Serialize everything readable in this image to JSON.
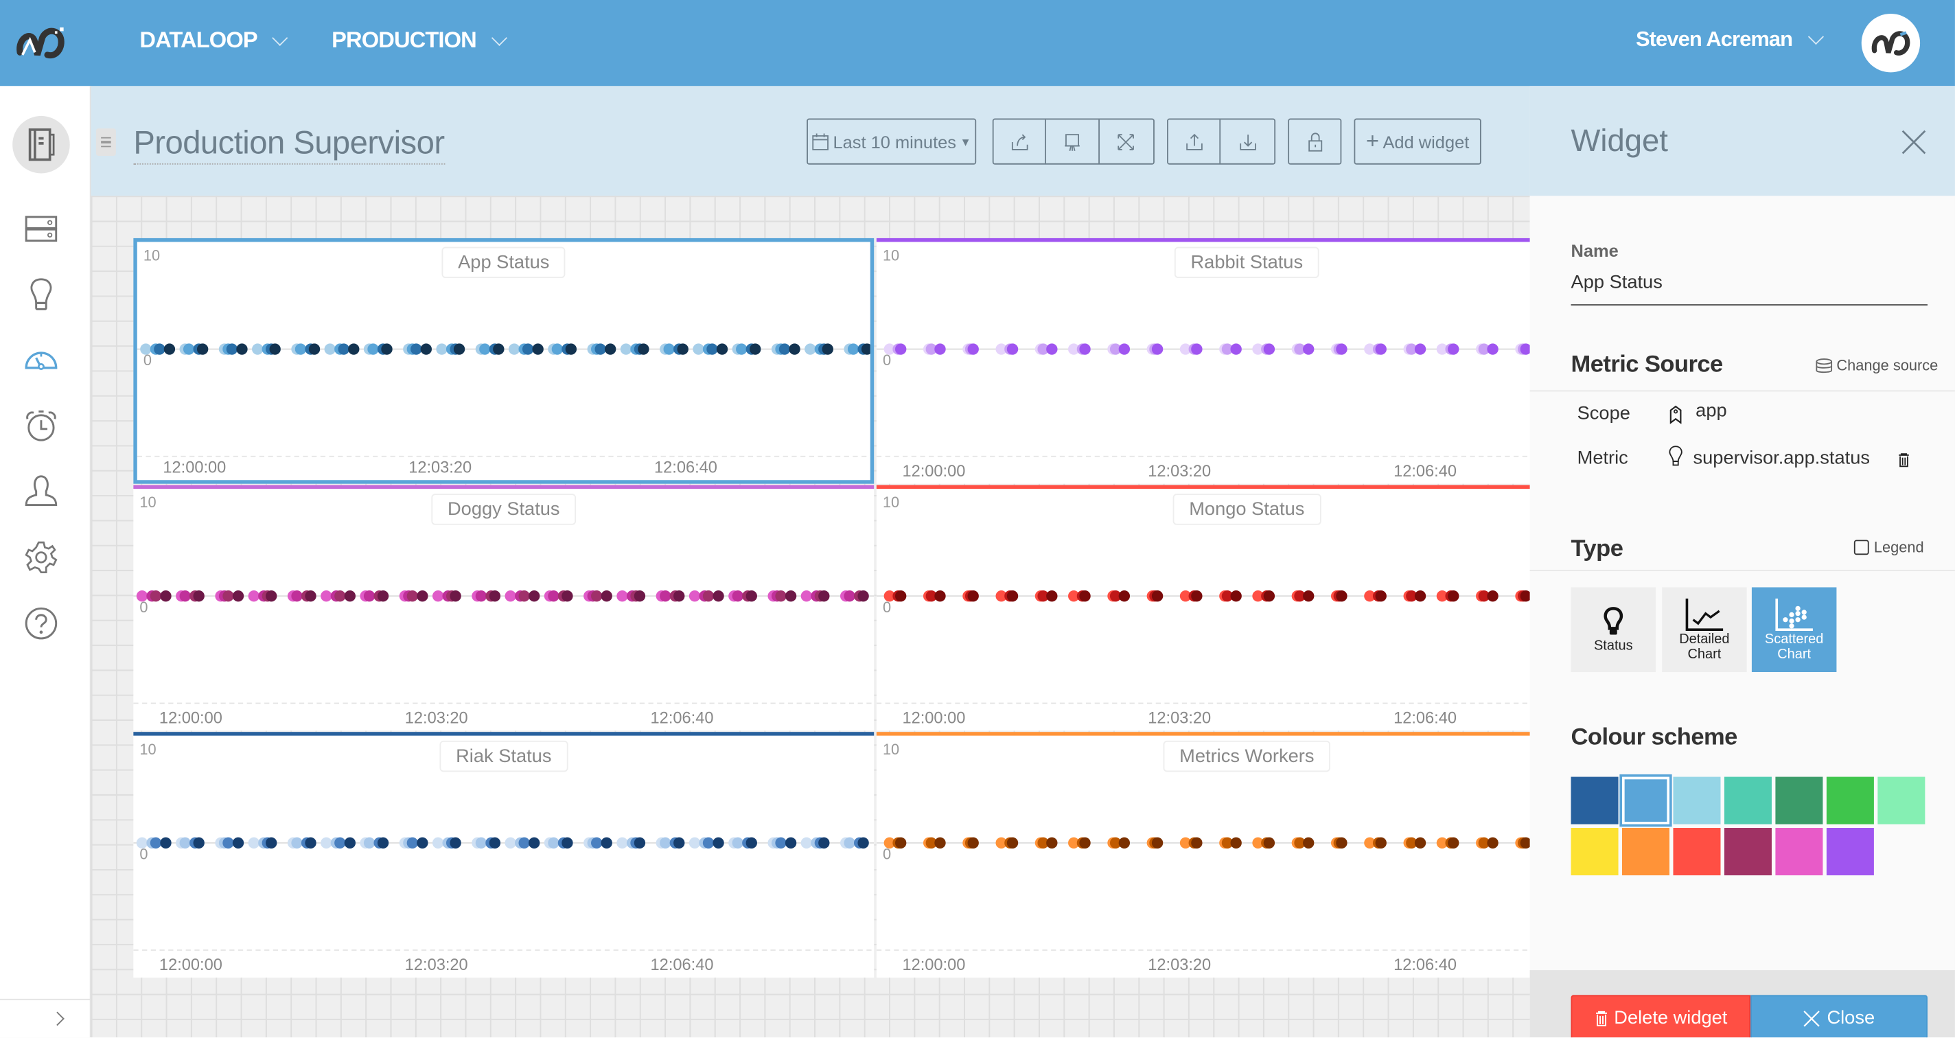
{
  "topbar": {
    "org": "DATALOOP",
    "env": "PRODUCTION",
    "user": "Steven Acreman"
  },
  "sidebar": {
    "items": [
      {
        "icon": "dashboards-book-icon",
        "active": false
      },
      {
        "icon": "servers-icon"
      },
      {
        "icon": "lightbulb-icon"
      },
      {
        "icon": "dashboard-gauge-icon",
        "active": true
      },
      {
        "icon": "alarm-clock-icon"
      },
      {
        "icon": "user-icon"
      },
      {
        "icon": "gear-icon"
      },
      {
        "icon": "help-icon"
      }
    ],
    "accent": "#5aa5d8"
  },
  "dashboard": {
    "title": "Production Supervisor",
    "time_range": "Last 10 minutes",
    "add_widget": "Add widget"
  },
  "chart_data": [
    {
      "type": "scatter",
      "title": "App Status",
      "color": "#5aa5d8",
      "selected": true,
      "ylim": [
        0,
        10
      ],
      "yticks": [
        "10",
        "0"
      ],
      "xticks": [
        "12:00:00",
        "12:03:20",
        "12:06:40"
      ],
      "x": [
        "11:59:30",
        "12:00:00",
        "12:00:30",
        "12:01:00",
        "12:01:30",
        "12:02:00",
        "12:02:30",
        "12:03:00",
        "12:03:30",
        "12:04:00",
        "12:04:30",
        "12:05:00",
        "12:05:30",
        "12:06:00",
        "12:06:30",
        "12:07:00",
        "12:07:30",
        "12:08:00",
        "12:08:30",
        "12:09:00"
      ],
      "series": [
        {
          "color": "#a8cfe9",
          "y": [
            0,
            0,
            0,
            0,
            0,
            0,
            0,
            0,
            0,
            0,
            0,
            0,
            0,
            0,
            0,
            0,
            0,
            0,
            0,
            0
          ]
        },
        {
          "color": "#5aa5d8",
          "y": [
            0,
            0,
            0,
            0,
            0,
            0,
            0,
            0,
            0,
            0,
            0,
            0,
            0,
            0,
            0,
            0,
            0,
            0,
            0,
            0
          ]
        },
        {
          "color": "#2a6fa8",
          "y": [
            0,
            0,
            0,
            0,
            0,
            0,
            0,
            0,
            0,
            0,
            0,
            0,
            0,
            0,
            0,
            0,
            0,
            0,
            0,
            0
          ]
        },
        {
          "color": "#133350",
          "y": [
            0,
            0,
            0,
            0,
            0,
            0,
            0,
            0,
            0,
            0,
            0,
            0,
            0,
            0,
            0,
            0,
            0,
            0,
            0,
            0
          ]
        }
      ]
    },
    {
      "type": "scatter",
      "title": "Rabbit Status",
      "color": "#a055f0",
      "ylim": [
        0,
        10
      ],
      "yticks": [
        "10",
        "0"
      ],
      "xticks": [
        "12:00:00",
        "12:03:20",
        "12:06:40"
      ],
      "x": [
        "11:59:30",
        "12:00:00",
        "12:00:30",
        "12:01:00",
        "12:01:30",
        "12:02:00",
        "12:02:30",
        "12:03:00",
        "12:03:30",
        "12:04:00",
        "12:04:30",
        "12:05:00",
        "12:05:30",
        "12:06:00",
        "12:06:30",
        "12:07:00",
        "12:07:30",
        "12:08:00",
        "12:08:30",
        "12:09:00"
      ],
      "series": [
        {
          "color": "#e6d4fb",
          "y": [
            0,
            0,
            0,
            0,
            0,
            0,
            0,
            0,
            0,
            0,
            0,
            0,
            0,
            0,
            0,
            0,
            0,
            0,
            0,
            0
          ]
        },
        {
          "color": "#c9a0f5",
          "y": [
            0,
            0,
            0,
            0,
            0,
            0,
            0,
            0,
            0,
            0,
            0,
            0,
            0,
            0,
            0,
            0,
            0,
            0,
            0,
            0
          ]
        },
        {
          "color": "#a055f0",
          "y": [
            0,
            0,
            0,
            0,
            0,
            0,
            0,
            0,
            0,
            0,
            0,
            0,
            0,
            0,
            0,
            0,
            0,
            0,
            0,
            0
          ]
        }
      ]
    },
    {
      "type": "scatter",
      "title": "Doggy Status",
      "color": "#c46ad8",
      "ylim": [
        0,
        10
      ],
      "yticks": [
        "10",
        "0"
      ],
      "xticks": [
        "12:00:00",
        "12:03:20",
        "12:06:40"
      ],
      "x": [
        "11:59:30",
        "12:00:00",
        "12:00:30",
        "12:01:00",
        "12:01:30",
        "12:02:00",
        "12:02:30",
        "12:03:00",
        "12:03:30",
        "12:04:00",
        "12:04:30",
        "12:05:00",
        "12:05:30",
        "12:06:00",
        "12:06:30",
        "12:07:00",
        "12:07:30",
        "12:08:00",
        "12:08:30",
        "12:09:00"
      ],
      "series": [
        {
          "color": "#e05bc8",
          "y": [
            0,
            0,
            0,
            0,
            0,
            0,
            0,
            0,
            0,
            0,
            0,
            0,
            0,
            0,
            0,
            0,
            0,
            0,
            0,
            0
          ]
        },
        {
          "color": "#c0309a",
          "y": [
            0,
            0,
            0,
            0,
            0,
            0,
            0,
            0,
            0,
            0,
            0,
            0,
            0,
            0,
            0,
            0,
            0,
            0,
            0,
            0
          ]
        },
        {
          "color": "#a0306a",
          "y": [
            0,
            0,
            0,
            0,
            0,
            0,
            0,
            0,
            0,
            0,
            0,
            0,
            0,
            0,
            0,
            0,
            0,
            0,
            0,
            0
          ]
        },
        {
          "color": "#6d1847",
          "y": [
            0,
            0,
            0,
            0,
            0,
            0,
            0,
            0,
            0,
            0,
            0,
            0,
            0,
            0,
            0,
            0,
            0,
            0,
            0,
            0
          ]
        }
      ]
    },
    {
      "type": "scatter",
      "title": "Mongo Status",
      "color": "#ff4f44",
      "ylim": [
        0,
        10
      ],
      "yticks": [
        "10",
        "0"
      ],
      "xticks": [
        "12:00:00",
        "12:03:20",
        "12:06:40"
      ],
      "x": [
        "11:59:30",
        "12:00:00",
        "12:00:30",
        "12:01:00",
        "12:01:30",
        "12:02:00",
        "12:02:30",
        "12:03:00",
        "12:03:30",
        "12:04:00",
        "12:04:30",
        "12:05:00",
        "12:05:30",
        "12:06:00",
        "12:06:30",
        "12:07:00",
        "12:07:30",
        "12:08:00",
        "12:08:30",
        "12:09:00"
      ],
      "series": [
        {
          "color": "#ff4f44",
          "y": [
            0,
            0,
            0,
            0,
            0,
            0,
            0,
            0,
            0,
            0,
            0,
            0,
            0,
            0,
            0,
            0,
            0,
            0,
            0,
            0
          ]
        },
        {
          "color": "#c01818",
          "y": [
            0,
            0,
            0,
            0,
            0,
            0,
            0,
            0,
            0,
            0,
            0,
            0,
            0,
            0,
            0,
            0,
            0,
            0,
            0,
            0
          ]
        },
        {
          "color": "#7a0a0a",
          "y": [
            0,
            0,
            0,
            0,
            0,
            0,
            0,
            0,
            0,
            0,
            0,
            0,
            0,
            0,
            0,
            0,
            0,
            0,
            0,
            0
          ]
        }
      ]
    },
    {
      "type": "scatter",
      "title": "Riak Status",
      "color": "#28619e",
      "ylim": [
        0,
        10
      ],
      "yticks": [
        "10",
        "0"
      ],
      "xticks": [
        "12:00:00",
        "12:03:20",
        "12:06:40"
      ],
      "x": [
        "11:59:30",
        "12:00:00",
        "12:00:30",
        "12:01:00",
        "12:01:30",
        "12:02:00",
        "12:02:30",
        "12:03:00",
        "12:03:30",
        "12:04:00",
        "12:04:30",
        "12:05:00",
        "12:05:30",
        "12:06:00",
        "12:06:30",
        "12:07:00",
        "12:07:30",
        "12:08:00",
        "12:08:30",
        "12:09:00"
      ],
      "series": [
        {
          "color": "#cfe0f3",
          "y": [
            0,
            0,
            0,
            0,
            0,
            0,
            0,
            0,
            0,
            0,
            0,
            0,
            0,
            0,
            0,
            0,
            0,
            0,
            0,
            0
          ]
        },
        {
          "color": "#a8c8ea",
          "y": [
            0,
            0,
            0,
            0,
            0,
            0,
            0,
            0,
            0,
            0,
            0,
            0,
            0,
            0,
            0,
            0,
            0,
            0,
            0,
            0
          ]
        },
        {
          "color": "#4a80c0",
          "y": [
            0,
            0,
            0,
            0,
            0,
            0,
            0,
            0,
            0,
            0,
            0,
            0,
            0,
            0,
            0,
            0,
            0,
            0,
            0,
            0
          ]
        },
        {
          "color": "#163e6e",
          "y": [
            0,
            0,
            0,
            0,
            0,
            0,
            0,
            0,
            0,
            0,
            0,
            0,
            0,
            0,
            0,
            0,
            0,
            0,
            0,
            0
          ]
        }
      ]
    },
    {
      "type": "scatter",
      "title": "Metrics Workers",
      "color": "#ff9338",
      "ylim": [
        0,
        10
      ],
      "yticks": [
        "10",
        "0"
      ],
      "xticks": [
        "12:00:00",
        "12:03:20",
        "12:06:40"
      ],
      "x": [
        "11:59:30",
        "12:00:00",
        "12:00:30",
        "12:01:00",
        "12:01:30",
        "12:02:00",
        "12:02:30",
        "12:03:00",
        "12:03:30",
        "12:04:00",
        "12:04:30",
        "12:05:00",
        "12:05:30",
        "12:06:00",
        "12:06:30",
        "12:07:00",
        "12:07:30",
        "12:08:00",
        "12:08:30",
        "12:09:00"
      ],
      "series": [
        {
          "color": "#ff9338",
          "y": [
            0,
            0,
            0,
            0,
            0,
            0,
            0,
            0,
            0,
            0,
            0,
            0,
            0,
            0,
            0,
            0,
            0,
            0,
            0,
            0
          ]
        },
        {
          "color": "#c05a00",
          "y": [
            0,
            0,
            0,
            0,
            0,
            0,
            0,
            0,
            0,
            0,
            0,
            0,
            0,
            0,
            0,
            0,
            0,
            0,
            0,
            0
          ]
        },
        {
          "color": "#7a3000",
          "y": [
            0,
            0,
            0,
            0,
            0,
            0,
            0,
            0,
            0,
            0,
            0,
            0,
            0,
            0,
            0,
            0,
            0,
            0,
            0,
            0
          ]
        }
      ]
    }
  ],
  "panel": {
    "title": "Widget",
    "name_label": "Name",
    "name_value": "App Status",
    "metric_source_title": "Metric Source",
    "change_source": "Change source",
    "scope_label": "Scope",
    "scope_value": "app",
    "metric_label": "Metric",
    "metric_value": "supervisor.app.status",
    "type_title": "Type",
    "legend_label": "Legend",
    "legend_checked": false,
    "types": [
      {
        "label1": "Status",
        "label2": "",
        "icon": "lightbulb-icon",
        "active": false
      },
      {
        "label1": "Detailed",
        "label2": "Chart",
        "icon": "line-chart-icon",
        "active": false
      },
      {
        "label1": "Scattered",
        "label2": "Chart",
        "icon": "scatter-chart-icon",
        "active": true
      }
    ],
    "colour_scheme_title": "Colour scheme",
    "colours": [
      "#28619e",
      "#5aa5d8",
      "#95d5e6",
      "#50ccb0",
      "#3b9b69",
      "#3fc54c",
      "#85efb3",
      "#fde232",
      "#ff9338",
      "#ff4f44",
      "#a03264",
      "#e85bc8",
      "#a055f0"
    ],
    "selected_colour": "#5aa5d8",
    "delete_label": "Delete widget",
    "close_label": "Close",
    "delete_color": "#ff4f44",
    "close_color": "#53a3d9"
  }
}
